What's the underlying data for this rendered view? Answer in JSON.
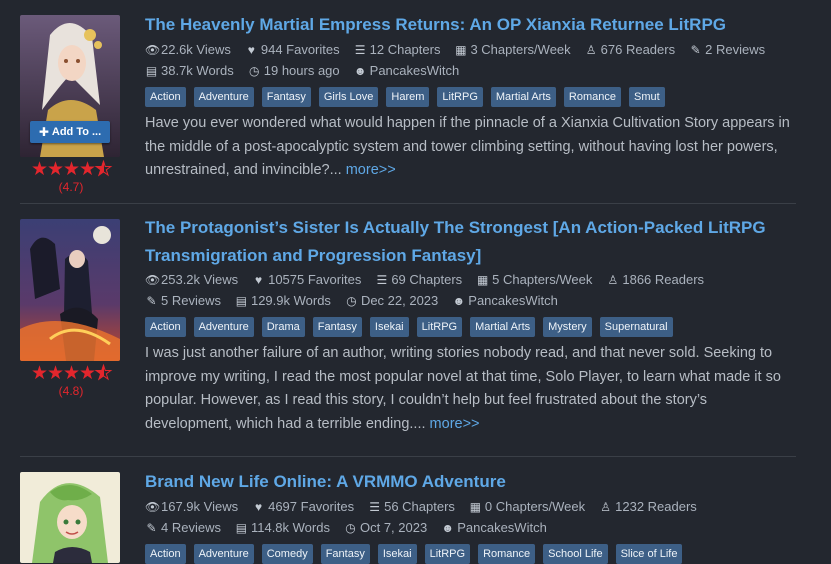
{
  "add_button_label": "Add To ...",
  "more_label": "more>>",
  "stories": [
    {
      "title": "The Heavenly Martial Empress Returns: An OP Xianxia Returnee LitRPG",
      "views": "22.6k Views",
      "favorites": "944 Favorites",
      "chapters": "12 Chapters",
      "per_week": "3 Chapters/Week",
      "readers": "676 Readers",
      "reviews": "2 Reviews",
      "words": "38.7k Words",
      "updated": "19 hours ago",
      "author": "PancakesWitch",
      "rating": "(4.7)",
      "rating_value": 4.7,
      "tags": [
        "Action",
        "Adventure",
        "Fantasy",
        "Girls Love",
        "Harem",
        "LitRPG",
        "Martial Arts",
        "Romance",
        "Smut"
      ],
      "description": "Have you ever wondered what would happen if the pinnacle of a Xianxia Cultivation Story appears in the middle of a post-apocalyptic system and tower climbing setting, without having lost her powers, unrestrained, and invincible?..."
    },
    {
      "title": "The Protagonist’s Sister Is Actually The Strongest [An Action-Packed LitRPG Transmigration and Progression Fantasy]",
      "views": "253.2k Views",
      "favorites": "10575 Favorites",
      "chapters": "69 Chapters",
      "per_week": "5 Chapters/Week",
      "readers": "1866 Readers",
      "reviews": "5 Reviews",
      "words": "129.9k Words",
      "updated": "Dec 22, 2023",
      "author": "PancakesWitch",
      "rating": "(4.8)",
      "rating_value": 4.8,
      "tags": [
        "Action",
        "Adventure",
        "Drama",
        "Fantasy",
        "Isekai",
        "LitRPG",
        "Martial Arts",
        "Mystery",
        "Supernatural"
      ],
      "description": "I was just another failure of an author, writing stories nobody read, and that never sold. Seeking to improve my writing, I read the most popular novel at that time, Solo Player, to learn what made it so popular. However, as I read this story, I couldn’t help but feel frustrated about the story’s development, which had a terrible ending...."
    },
    {
      "title": "Brand New Life Online: A VRMMO Adventure",
      "views": "167.9k Views",
      "favorites": "4697 Favorites",
      "chapters": "56 Chapters",
      "per_week": "0 Chapters/Week",
      "readers": "1232 Readers",
      "reviews": "4 Reviews",
      "words": "114.8k Words",
      "updated": "Oct 7, 2023",
      "author": "PancakesWitch",
      "tags": [
        "Action",
        "Adventure",
        "Comedy",
        "Fantasy",
        "Isekai",
        "LitRPG",
        "Romance",
        "School Life",
        "Slice of Life"
      ]
    }
  ],
  "colors": {
    "background": "#23272f",
    "title": "#5fa8e6",
    "tag_bg": "#3d5f86",
    "star": "#e3262d",
    "button": "#2d6cb0"
  }
}
